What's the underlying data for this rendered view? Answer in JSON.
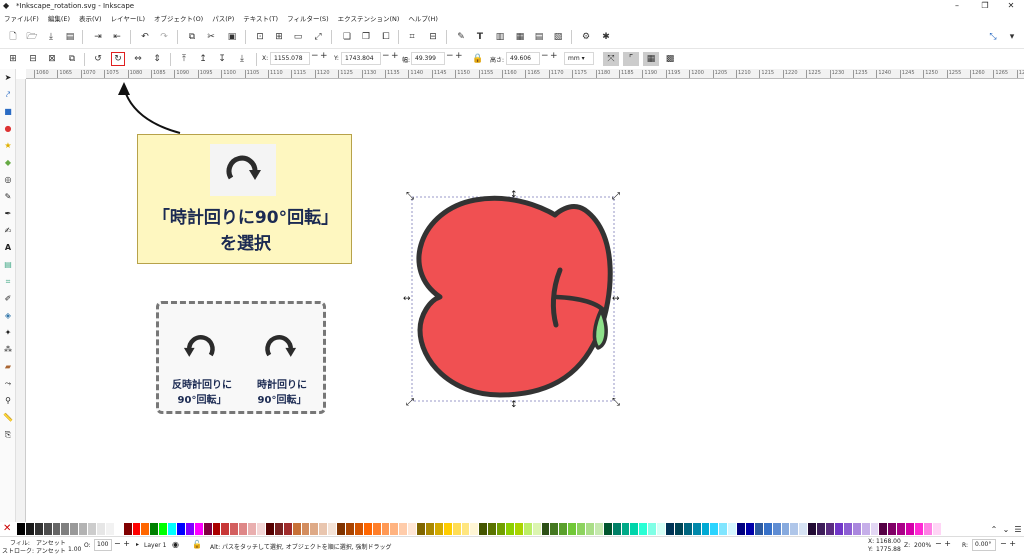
{
  "window": {
    "title": "*Inkscape_rotation.svg - Inkscape",
    "controls": [
      "–",
      "❐",
      "✕"
    ]
  },
  "menu": [
    "ファイル(F)",
    "編集(E)",
    "表示(V)",
    "レイヤー(L)",
    "オブジェクト(O)",
    "パス(P)",
    "テキスト(T)",
    "フィルター(S)",
    "エクステンション(N)",
    "ヘルプ(H)"
  ],
  "controls": {
    "x_label": "X:",
    "x_value": "1155.078",
    "y_label": "Y:",
    "y_value": "1743.804",
    "w_label": "幅:",
    "w_value": "49.399",
    "h_label": "高さ:",
    "h_value": "49.606",
    "unit": "mm"
  },
  "ruler_ticks": [
    "1060",
    "1065",
    "1070",
    "1075",
    "1080",
    "1085",
    "1090",
    "1095",
    "1100",
    "1105",
    "1110",
    "1115",
    "1120",
    "1125",
    "1130",
    "1135",
    "1140",
    "1145",
    "1150",
    "1155",
    "1160",
    "1165",
    "1170",
    "1175",
    "1180",
    "1185",
    "1190",
    "1195",
    "1200",
    "1205",
    "1210",
    "1215",
    "1220",
    "1225",
    "1230",
    "1235",
    "1240",
    "1245",
    "1250",
    "1255",
    "1260",
    "1265",
    "1270"
  ],
  "callout_main": {
    "line1": "「時計回りに90°回転」",
    "line2": "を選択"
  },
  "callout_compare": {
    "left_line1": "反時計回りに",
    "left_line2": "90°回転」",
    "right_line1": "時計回りに",
    "right_line2": "90°回転」"
  },
  "palette_colors": [
    "#000000",
    "#1a1a1a",
    "#333333",
    "#4d4d4d",
    "#666666",
    "#808080",
    "#999999",
    "#b3b3b3",
    "#cccccc",
    "#e6e6e6",
    "#f2f2f2",
    "#ffffff",
    "#800000",
    "#ff0000",
    "#ff6600",
    "#008000",
    "#00ff00",
    "#00ffff",
    "#0000ff",
    "#8000ff",
    "#ff00ff",
    "#800040",
    "#aa0000",
    "#c83737",
    "#d35f5f",
    "#de8787",
    "#e9afaf",
    "#f4d7d7",
    "#550000",
    "#782121",
    "#a02c2c",
    "#c87137",
    "#d38d5f",
    "#deaa87",
    "#e9c6af",
    "#f4e3d7",
    "#803300",
    "#aa4400",
    "#d45500",
    "#ff6600",
    "#ff7f2a",
    "#ff9955",
    "#ffb380",
    "#ffccaa",
    "#ffe6d5",
    "#806600",
    "#aa8800",
    "#d4aa00",
    "#ffcc00",
    "#ffdd55",
    "#ffe680",
    "#fff6d5",
    "#445500",
    "#5a7400",
    "#71a000",
    "#8cd000",
    "#aad400",
    "#bcee68",
    "#dcf5b0",
    "#2d5016",
    "#447821",
    "#5aa02c",
    "#71c837",
    "#8dd35f",
    "#aade87",
    "#c6e9af",
    "#00552e",
    "#008066",
    "#00aa88",
    "#00d4aa",
    "#2affd5",
    "#80ffe6",
    "#d5fff6",
    "#003355",
    "#004455",
    "#006680",
    "#0088aa",
    "#00aad4",
    "#2ad4ff",
    "#80e5ff",
    "#d5f6ff",
    "#000080",
    "#0000aa",
    "#2c5aa0",
    "#3771c8",
    "#5f8dd3",
    "#87aade",
    "#afc6e9",
    "#d7e3f4",
    "#220b34",
    "#3e1e5a",
    "#5a2c80",
    "#7137c8",
    "#8d5fd3",
    "#aa87de",
    "#c6afe9",
    "#e3d7f4",
    "#550044",
    "#800066",
    "#aa0088",
    "#d400aa",
    "#ff2ad4",
    "#ff80e5",
    "#ffd5f6"
  ],
  "status": {
    "fill_label": "フィル:",
    "fill_value": "アンセット",
    "stroke_label": "ストローク:",
    "stroke_value": "アンセット",
    "stroke_width": "1.00",
    "o_label": "O:",
    "opacity": "100",
    "layer": "Layer 1",
    "message": "Alt: パスをタッチして選択, オブジェクトを順に選択, 強制ドラッグ",
    "x_label": "X:",
    "x": "1168.00",
    "y_label": "Y:",
    "y": "1775.88",
    "z_label": "Z:",
    "zoom": "200%",
    "r_label": "R:",
    "rotation": "0.00°"
  }
}
